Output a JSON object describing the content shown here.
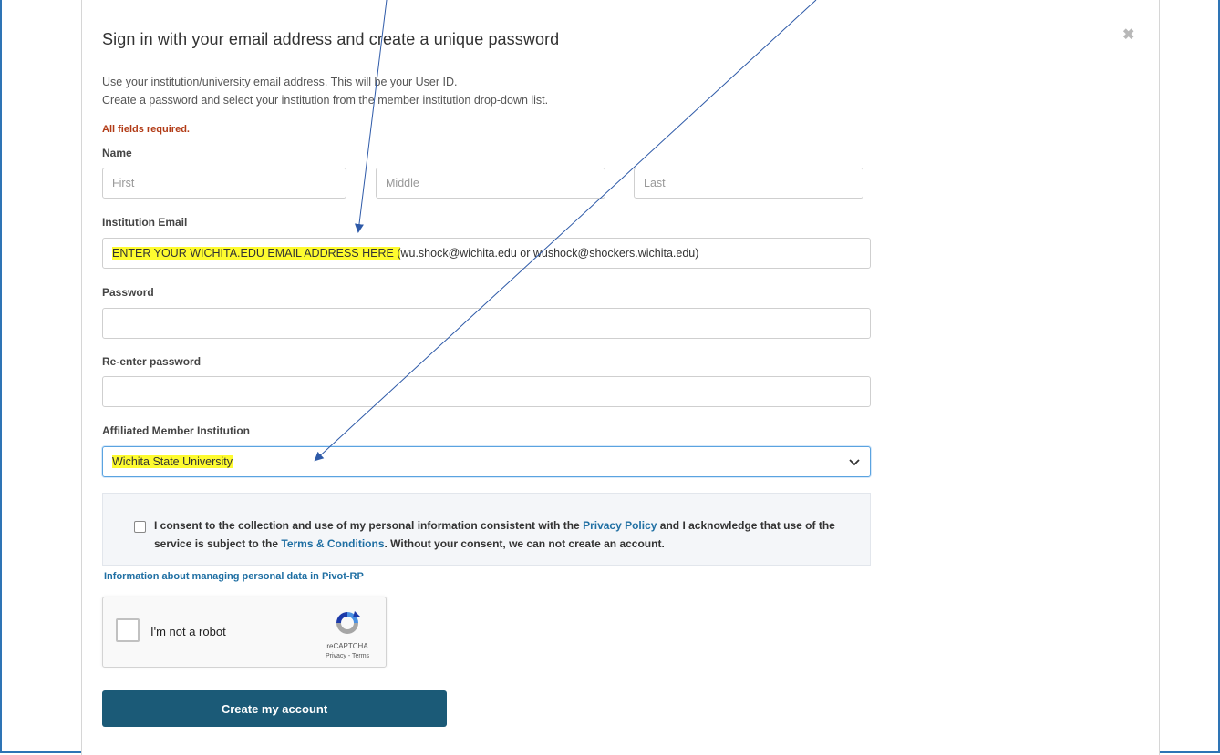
{
  "modal": {
    "title": "Sign in with your email address and create a unique password",
    "close_glyph": "✖",
    "intro_line1": "Use your institution/university email address. This will be your User ID.",
    "intro_line2": "Create a password and select your institution from the member institution drop-down list.",
    "required_note": "All fields required."
  },
  "form": {
    "name_label": "Name",
    "first_placeholder": "First",
    "middle_placeholder": "Middle",
    "last_placeholder": "Last",
    "email_label": "Institution Email",
    "email_value_highlight": "ENTER YOUR WICHITA.EDU EMAIL ADDRESS HERE (",
    "email_value_rest": "wu.shock@wichita.edu or wushock@shockers.wichita.edu)",
    "password_label": "Password",
    "password_value": "",
    "reenter_label": "Re-enter password",
    "reenter_value": "",
    "institution_label": "Affiliated Member Institution",
    "institution_selected": "Wichita State University"
  },
  "consent": {
    "text1": "I consent to the collection and use of my personal information consistent with the ",
    "privacy_link": "Privacy Policy",
    "text2": " and I acknowledge that use of the service is subject to the ",
    "terms_link": "Terms & Conditions",
    "text3": ". Without your consent, we can not create an account."
  },
  "info_link": "Information about managing personal data in Pivot-RP",
  "captcha": {
    "label": "I'm not a robot",
    "brand": "reCAPTCHA",
    "terms": "Privacy - Terms"
  },
  "submit_label": "Create my account",
  "colors": {
    "accent": "#1b5a77",
    "link": "#1f6fa3",
    "required": "#b23b16",
    "highlight": "#fefb2f",
    "arrow": "#2e5aa8"
  },
  "icons": {
    "close": "close-icon",
    "chevron": "chevron-down-icon",
    "recaptcha": "recaptcha-logo-icon"
  }
}
